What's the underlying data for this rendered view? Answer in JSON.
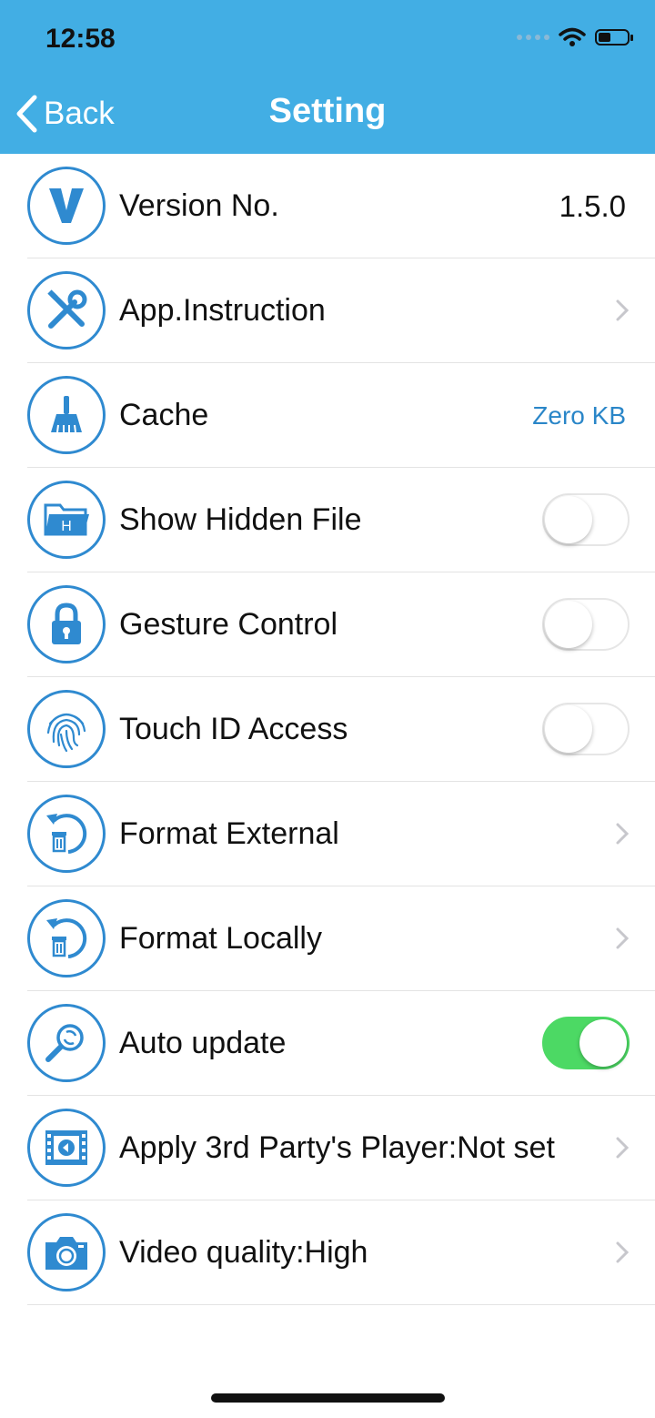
{
  "status_bar": {
    "time": "12:58"
  },
  "nav": {
    "back_label": "Back",
    "title": "Setting"
  },
  "settings": [
    {
      "label": "Version No.",
      "value": "1.5.0",
      "icon": "v-letter-icon"
    },
    {
      "label": "App.Instruction",
      "icon": "tools-icon"
    },
    {
      "label": "Cache",
      "value": "Zero KB",
      "icon": "broom-icon"
    },
    {
      "label": "Show Hidden File",
      "toggle": "off",
      "icon": "hidden-folder-icon"
    },
    {
      "label": "Gesture Control",
      "toggle": "off",
      "icon": "lock-icon"
    },
    {
      "label": "Touch ID Access",
      "toggle": "off",
      "icon": "fingerprint-icon"
    },
    {
      "label": "Format External",
      "icon": "format-trash-icon"
    },
    {
      "label": "Format Locally",
      "icon": "format-trash-icon"
    },
    {
      "label": "Auto update",
      "toggle": "on",
      "icon": "search-refresh-icon"
    },
    {
      "label": "Apply 3rd Party's Player:Not set",
      "icon": "film-play-icon"
    },
    {
      "label": "Video quality:High",
      "icon": "camera-icon"
    }
  ],
  "colors": {
    "header": "#42aee4",
    "icon_blue": "#2f8ad0",
    "toggle_on": "#4cd964"
  }
}
